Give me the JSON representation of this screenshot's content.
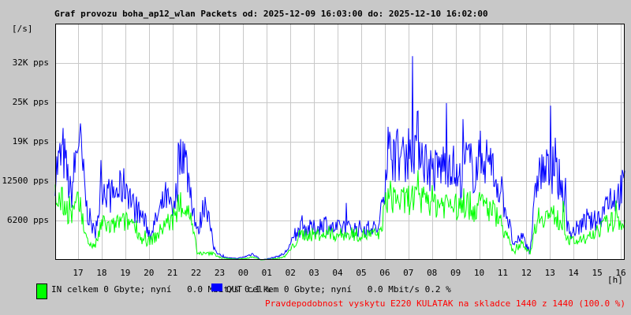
{
  "chart_data": {
    "type": "line",
    "title": "Graf provozu boha_ap12_wlan Packets od: 2025-12-09 16:03:00 do: 2025-12-10 16:02:00",
    "ylabel": "[/s]",
    "xlabel": "[h]",
    "unit": "kpps",
    "ylim": [
      0,
      37.5
    ],
    "grid": true,
    "y_ticks": [
      {
        "value": 6.2,
        "label": "6200 pps"
      },
      {
        "value": 12.5,
        "label": "12500 pps"
      },
      {
        "value": 18.75,
        "label": "19K pps"
      },
      {
        "value": 25,
        "label": "25K pps"
      },
      {
        "value": 31.25,
        "label": "32K pps"
      }
    ],
    "x_ticks": [
      "17",
      "18",
      "19",
      "20",
      "21",
      "22",
      "23",
      "00",
      "01",
      "02",
      "03",
      "04",
      "05",
      "06",
      "07",
      "08",
      "09",
      "10",
      "11",
      "12",
      "13",
      "14",
      "15",
      "16"
    ],
    "series": [
      {
        "name": "IN",
        "color": "#00ff00",
        "values": [
          10,
          9,
          7,
          9,
          3,
          2,
          6,
          5,
          6,
          6,
          6,
          3,
          3,
          4,
          6,
          6,
          9,
          7,
          1,
          1,
          1,
          0.3,
          0.2,
          0.1,
          0.2,
          0.5,
          0,
          0.1,
          0.2,
          0.5,
          2,
          4,
          4,
          4,
          4,
          4,
          4,
          4,
          4,
          4,
          4,
          4,
          10,
          10,
          9,
          10,
          9,
          10,
          9,
          9,
          9,
          8,
          9,
          8,
          9,
          8,
          7,
          4,
          1,
          3,
          1,
          7,
          7,
          7,
          6,
          3,
          3,
          3,
          4,
          5,
          6,
          6,
          6
        ]
      },
      {
        "name": "OUT",
        "color": "#0000ff",
        "values": [
          14,
          17,
          10,
          20,
          8,
          4,
          12,
          10,
          11,
          12,
          8,
          7,
          4,
          7,
          10,
          7,
          19,
          12,
          4,
          10,
          2,
          0.5,
          0.3,
          0.2,
          0.5,
          1,
          0,
          0.2,
          0.5,
          1,
          3,
          5,
          5,
          5,
          6,
          5,
          5,
          5,
          5,
          5,
          5,
          5,
          17,
          17,
          16,
          18,
          19,
          15,
          14,
          15,
          16,
          12,
          16,
          14,
          17,
          15,
          12,
          8,
          2,
          4,
          1,
          14,
          14,
          14,
          12,
          4,
          5,
          6,
          6,
          7,
          10,
          10,
          12
        ]
      }
    ]
  },
  "legend": {
    "in_text": "IN celkem 0 Gbyte; nyní   0.0 Mbit/s 0.1 %",
    "out_text": "OUT celkem 0 Gbyte; nyní   0.0 Mbit/s 0.2 %"
  },
  "note": "Pravdepodobnost vyskytu E220 KULATAK na skladce 1440 z 1440 (100.0 %)"
}
